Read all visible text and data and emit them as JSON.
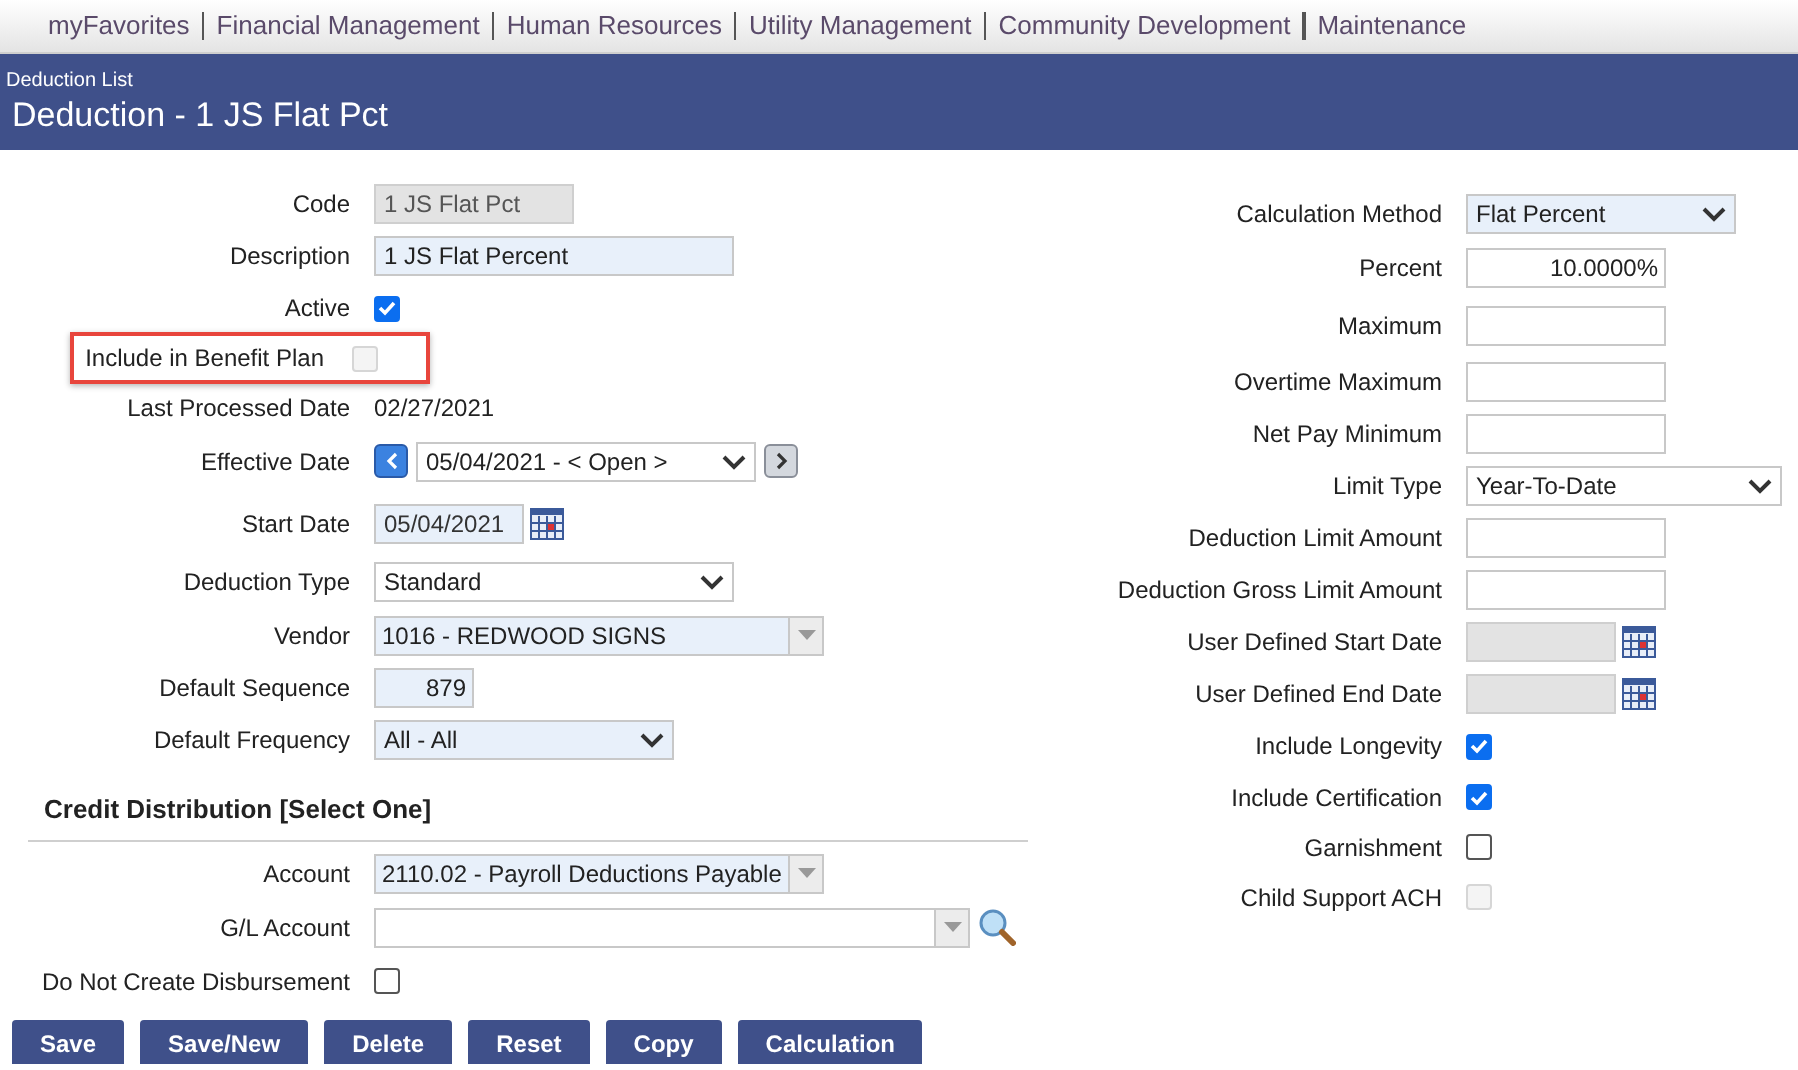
{
  "nav": [
    "myFavorites",
    "Financial Management",
    "Human Resources",
    "Utility Management",
    "Community Development",
    "Maintenance"
  ],
  "breadcrumb": "Deduction List",
  "title": "Deduction - 1 JS Flat Pct",
  "left_fields": [
    {
      "kind": "text",
      "label": "Code",
      "value": "1 JS Flat Pct",
      "readonly": true
    },
    {
      "kind": "text",
      "label": "Description",
      "value": "1 JS Flat Percent",
      "readonly": false
    },
    {
      "kind": "checkbox",
      "label": "Active",
      "checked": true,
      "disabled": false,
      "highlighted": false
    },
    {
      "kind": "checkbox",
      "label": "Include in Benefit Plan",
      "checked": false,
      "disabled": true,
      "highlighted": true
    },
    {
      "kind": "value",
      "label": "Last Processed Date",
      "value": "02/27/2021"
    },
    {
      "kind": "nav_select",
      "label": "Effective Date",
      "value": "05/04/2021 - < Open >"
    },
    {
      "kind": "date",
      "label": "Start Date",
      "value": "05/04/2021",
      "readonly": false
    },
    {
      "kind": "select",
      "label": "Deduction Type",
      "value": "Standard",
      "tinted": false
    },
    {
      "kind": "combo",
      "label": "Vendor",
      "value": "1016 - REDWOOD SIGNS"
    },
    {
      "kind": "number",
      "label": "Default Sequence",
      "value": "879"
    },
    {
      "kind": "select",
      "label": "Default Frequency",
      "value": "All - All",
      "tinted": true
    }
  ],
  "credit_heading": "Credit Distribution [Select One]",
  "credit_fields": [
    {
      "kind": "combo",
      "label": "Account",
      "value": "2110.02 - Payroll Deductions Payable"
    },
    {
      "kind": "search_combo",
      "label": "G/L Account"
    },
    {
      "kind": "checkbox",
      "label": "Do Not Create Disbursement",
      "checked": false,
      "disabled": false,
      "highlighted": false
    }
  ],
  "right_fields": [
    {
      "kind": "select",
      "label": "Calculation Method",
      "value": "Flat Percent",
      "tinted": true
    },
    {
      "kind": "number",
      "label": "Percent",
      "value": "10.0000%"
    },
    {
      "kind": "text",
      "label": "Maximum",
      "readonly": false
    },
    {
      "kind": "text",
      "label": "Overtime Maximum",
      "readonly": false
    },
    {
      "kind": "text",
      "label": "Net Pay Minimum",
      "readonly": false
    },
    {
      "kind": "select",
      "label": "Limit Type",
      "value": "Year-To-Date",
      "tinted": false
    },
    {
      "kind": "text",
      "label": "Deduction Limit Amount",
      "readonly": false
    },
    {
      "kind": "text",
      "label": "Deduction Gross Limit Amount",
      "readonly": false
    },
    {
      "kind": "date",
      "label": "User Defined Start Date",
      "readonly": true
    },
    {
      "kind": "date",
      "label": "User Defined End Date",
      "readonly": true
    },
    {
      "kind": "checkbox",
      "label": "Include Longevity",
      "checked": true,
      "disabled": false,
      "highlighted": false
    },
    {
      "kind": "checkbox",
      "label": "Include Certification",
      "checked": true,
      "disabled": false,
      "highlighted": false
    },
    {
      "kind": "checkbox",
      "label": "Garnishment",
      "checked": false,
      "disabled": false,
      "highlighted": false
    },
    {
      "kind": "checkbox",
      "label": "Child Support ACH",
      "checked": false,
      "disabled": true,
      "highlighted": false
    }
  ],
  "buttons": [
    "Save",
    "Save/New",
    "Delete",
    "Reset",
    "Copy",
    "Calculation"
  ]
}
